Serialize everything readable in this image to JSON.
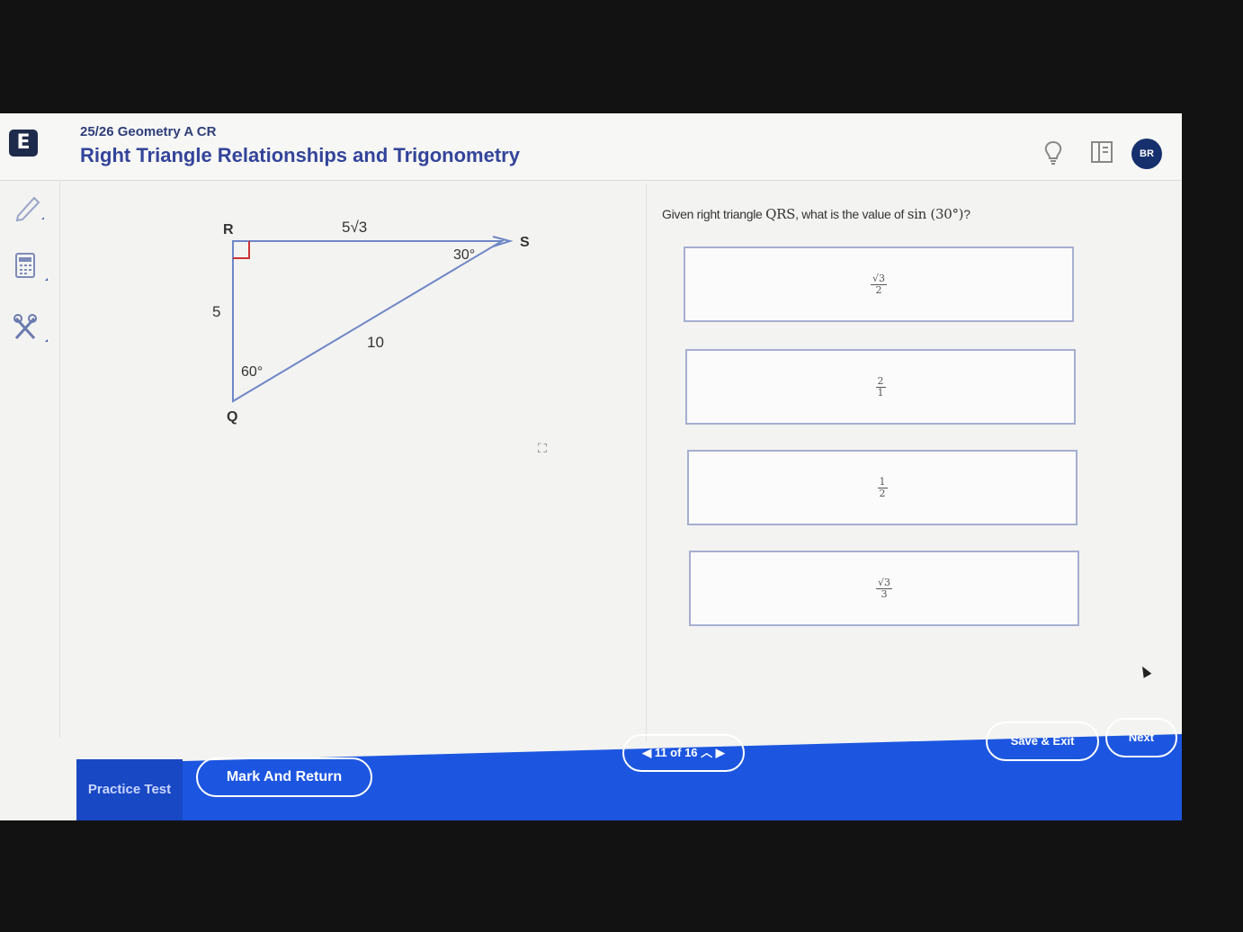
{
  "header": {
    "logo_letter": "E",
    "course": "25/26 Geometry A CR",
    "unit": "Right Triangle Relationships and Trigonometry",
    "avatar_initials": "BR"
  },
  "tools": [
    "pen-icon",
    "calculator-icon",
    "tools-icon"
  ],
  "figure": {
    "vertex_r": "R",
    "vertex_s": "S",
    "vertex_q": "Q",
    "side_rs": "5√3",
    "side_rq": "5",
    "side_qs": "10",
    "angle_s": "30°",
    "angle_q": "60°"
  },
  "question": {
    "prefix": "Given right triangle ",
    "triangle": "QRS",
    "middle": ", what is the value of ",
    "expression": "sin (30°)",
    "suffix": "?"
  },
  "choices": [
    {
      "numerator": "√3",
      "denominator": "2"
    },
    {
      "numerator": "2",
      "denominator": "1"
    },
    {
      "numerator": "1",
      "denominator": "2"
    },
    {
      "numerator": "√3",
      "denominator": "3"
    }
  ],
  "footer": {
    "practice_label": "Practice Test",
    "mark_label": "Mark And Return",
    "progress": "11 of 16",
    "save_label": "Save & Exit",
    "next_label": "Next"
  },
  "colors": {
    "accent_blue": "#1c56e0",
    "title_blue": "#33449a",
    "right_angle_marker": "#cc3333",
    "triangle_stroke": "#6f86c7"
  }
}
